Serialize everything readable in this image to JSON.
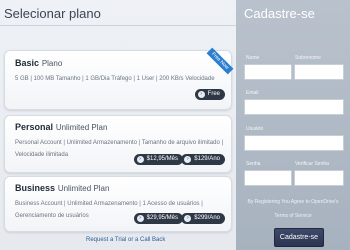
{
  "left": {
    "title": "Selecionar plano",
    "plans": [
      {
        "name_bold": "Basic",
        "name_rest": "Plano",
        "desc": "5 GB | 100 MB Tamanho | 1 GB/Dia Tráfego | 1 User | 200 KB/s Velocidade",
        "ribbon": "Free Now",
        "buttons": [
          "Free"
        ]
      },
      {
        "name_bold": "Personal",
        "name_rest": "Unlimited Plan",
        "desc": "Personal Account | Unlimited Armazenamento | Tamanho de arquivo ilimitado | Velocidade ilimitada",
        "buttons": [
          "$12,95/Mês",
          "$129/Ano"
        ]
      },
      {
        "name_bold": "Business",
        "name_rest": "Unlimited Plan",
        "desc": "Business Account | Unlimited Armazenamento | 1 Acesso de usuários | Gerenciamento de usuários",
        "buttons": [
          "$29,95/Mês",
          "$299/Ano"
        ]
      }
    ],
    "trial_link": "Request a Trial or a Call Back"
  },
  "right": {
    "title": "Cadastre-se",
    "fields": {
      "nome": "Nome",
      "sobrenome": "Sobrenome",
      "email": "Email",
      "usuario": "Usuário",
      "senha": "Senha",
      "verificar_senha": "Verificar Senha"
    },
    "terms_text": "By Registering You Agree to OpenDrive's",
    "terms_link": "Terms of Service",
    "button": "Cadastre-se"
  }
}
